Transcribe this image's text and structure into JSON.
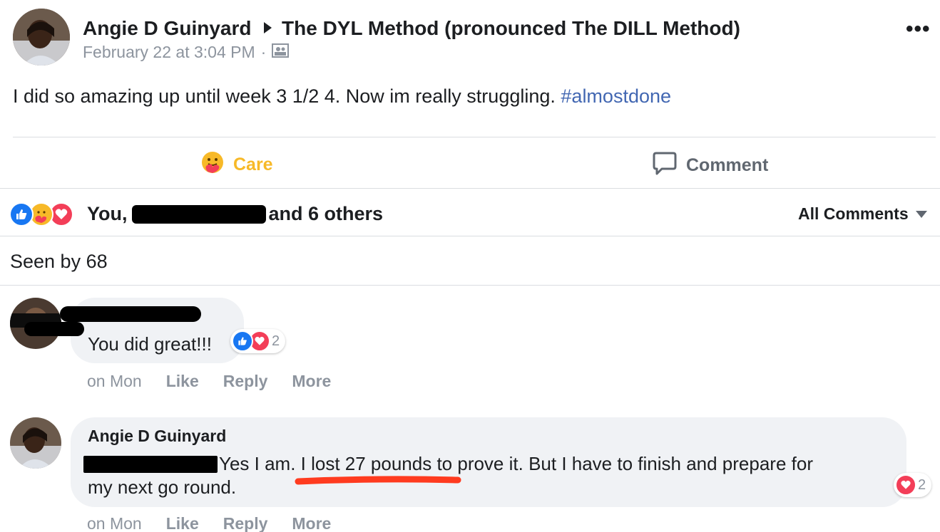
{
  "post": {
    "author": "Angie D Guinyard",
    "group": "The DYL Method (pronounced The DILL Method)",
    "timestamp": "February 22 at 3:04 PM",
    "separator": "·",
    "text": "I did so amazing up until week 3 1/2 4. Now im really struggling.",
    "hashtag": "#almostdone"
  },
  "actions": {
    "care_label": "Care",
    "comment_label": "Comment"
  },
  "reactions": {
    "prefix": "You,",
    "suffix": "and 6 others",
    "icons": [
      "like-icon",
      "care-icon",
      "love-icon"
    ]
  },
  "comments_filter": {
    "label": "All Comments"
  },
  "seen_by": "Seen by 68",
  "comments": [
    {
      "text": "You did great!!!",
      "reaction_count": "2",
      "time": "on Mon",
      "like": "Like",
      "reply": "Reply",
      "more": "More"
    },
    {
      "author": "Angie D Guinyard",
      "text_line1": "Yes I am. I lost 27 pounds to prove it. But I have to finish and prepare for",
      "text_line2": "my next go round.",
      "reaction_count": "2",
      "time": "on Mon",
      "like": "Like",
      "reply": "Reply",
      "more": "More"
    }
  ],
  "colors": {
    "care": "#f7b928",
    "like": "#1877f2",
    "love": "#f33e58",
    "hashtag": "#4267b2",
    "annotation_underline": "#ff3b1f"
  }
}
